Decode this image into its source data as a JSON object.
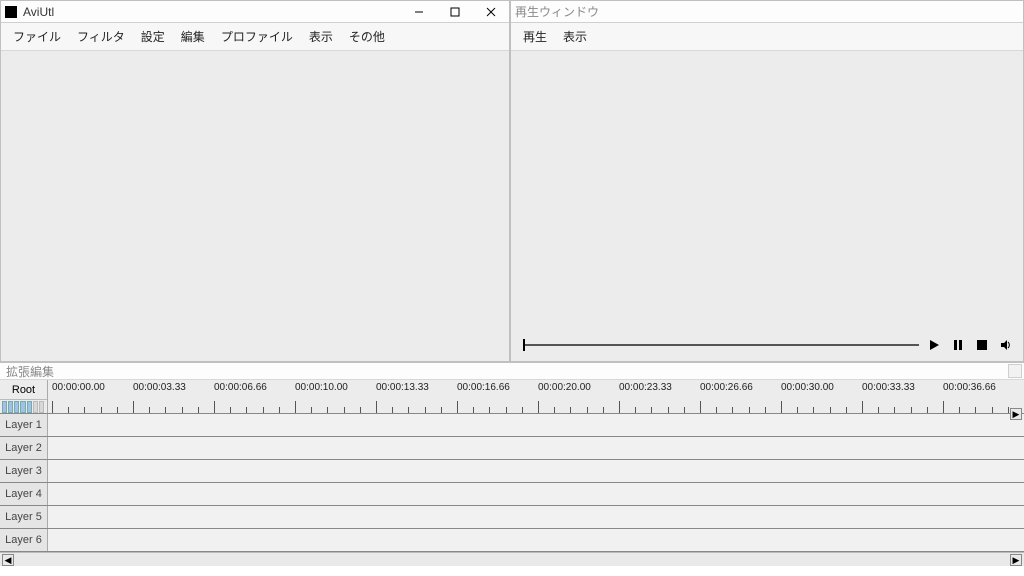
{
  "main_window": {
    "title": "AviUtl",
    "menus": [
      "ファイル",
      "フィルタ",
      "設定",
      "編集",
      "プロファイル",
      "表示",
      "その他"
    ]
  },
  "play_window": {
    "title": "再生ウィンドウ",
    "menus": [
      "再生",
      "表示"
    ]
  },
  "ext_window": {
    "title": "拡張編集",
    "root_label": "Root",
    "time_labels": [
      "00:00:00.00",
      "00:00:03.33",
      "00:00:06.66",
      "00:00:10.00",
      "00:00:13.33",
      "00:00:16.66",
      "00:00:20.00",
      "00:00:23.33",
      "00:00:26.66",
      "00:00:30.00",
      "00:00:33.33",
      "00:00:36.66"
    ],
    "layers": [
      "Layer 1",
      "Layer 2",
      "Layer 3",
      "Layer 4",
      "Layer 5",
      "Layer 6"
    ]
  }
}
